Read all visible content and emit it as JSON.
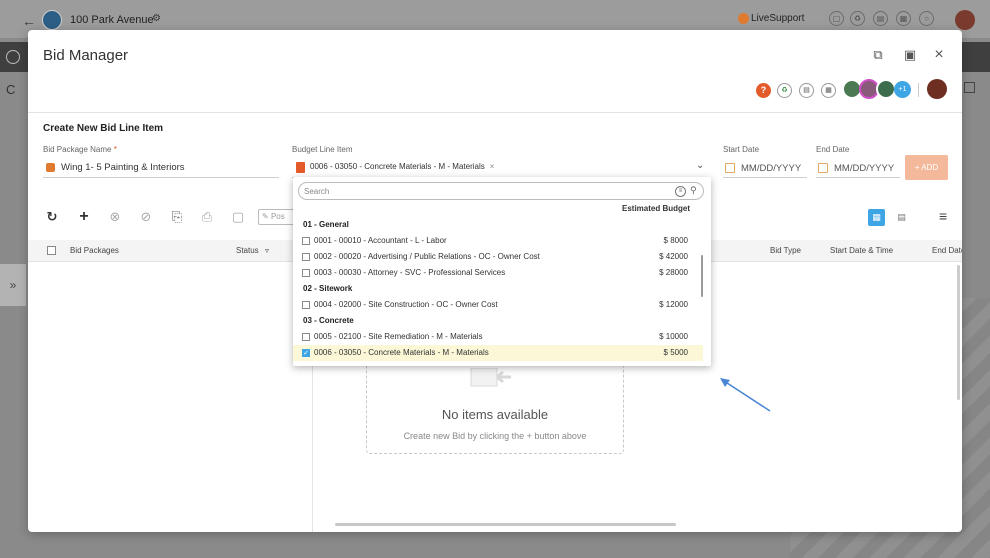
{
  "background": {
    "project_name": "100 Park Avenue",
    "live_support": "LiveSupport",
    "letter": "C"
  },
  "modal": {
    "title": "Bid Manager",
    "avatar_more": "+1",
    "help_label": "?"
  },
  "form": {
    "section_title": "Create New Bid Line Item",
    "bid_package_label": "Bid Package Name",
    "required_mark": "*",
    "bid_package_value": "Wing 1- 5 Painting & Interiors",
    "budget_line_label": "Budget Line Item",
    "budget_chip": "0006 - 03050 - Concrete Materials - M - Materials",
    "start_date_label": "Start Date",
    "end_date_label": "End Date",
    "start_date_placeholder": "MM/DD/YYYY",
    "end_date_placeholder": "MM/DD/YYYY",
    "add_button": "+ ADD"
  },
  "toolbar": {
    "post_label": "Pos"
  },
  "grid": {
    "col_bid_packages": "Bid Packages",
    "col_status": "Status",
    "col_bid_type": "Bid Type",
    "col_start": "Start Date & Time",
    "col_end": "End Date"
  },
  "empty": {
    "title": "No items available",
    "subtitle": "Create new Bid by clicking the + button above"
  },
  "dropdown": {
    "search_placeholder": "Search",
    "column_header": "Estimated Budget",
    "groups": [
      {
        "name": "01 - General"
      },
      {
        "name": "02 - Sitework"
      },
      {
        "name": "03 - Concrete"
      }
    ],
    "items": [
      {
        "label": "0001 - 00010 - Accountant - L - Labor",
        "amount": "$ 8000"
      },
      {
        "label": "0002 - 00020 - Advertising / Public Relations - OC - Owner Cost",
        "amount": "$ 42000"
      },
      {
        "label": "0003 - 00030 - Attorney - SVC - Professional Services",
        "amount": "$ 28000"
      },
      {
        "label": "0004 - 02000 - Site Construction - OC - Owner Cost",
        "amount": "$ 12000"
      },
      {
        "label": "0005 - 02100 - Site Remediation - M - Materials",
        "amount": "$ 10000"
      },
      {
        "label": "0006 - 03050 - Concrete Materials - M - Materials",
        "amount": "$ 5000",
        "checked": true
      }
    ]
  },
  "colors": {
    "accent_blue": "#3fa6e6",
    "accent_orange": "#e35b2b",
    "add_button_bg": "#f4b89a",
    "selected_row": "#fbf7d7"
  }
}
